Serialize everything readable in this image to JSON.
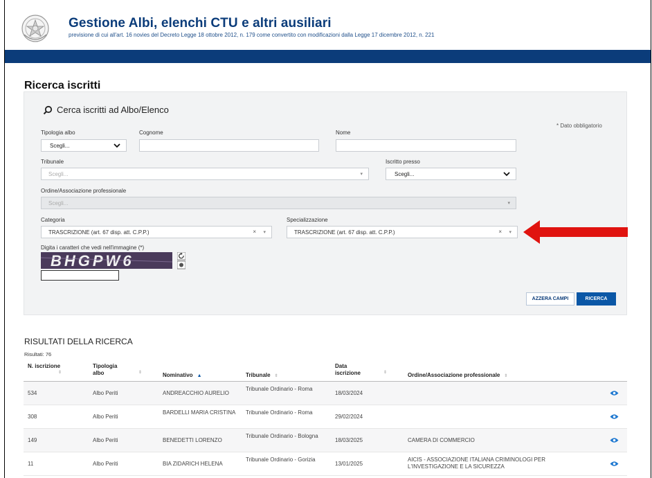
{
  "header": {
    "title": "Gestione Albi, elenchi CTU e altri ausiliari",
    "subtitle": "previsione di cui all'art. 16 novies del Decreto Legge 18 ottobre 2012, n. 179 come convertito con modificazioni dalla Legge 17 dicembre 2012, n. 221",
    "emblem_icon": "republic-emblem-icon",
    "brand_color": "#0b3c7a"
  },
  "page": {
    "title": "Ricerca iscritti"
  },
  "search": {
    "heading": "Cerca iscritti ad Albo/Elenco",
    "heading_icon": "search-icon",
    "required_note": "* Dato obbligatorio",
    "tipologia": {
      "label": "Tipologia albo",
      "value": "Scegli..."
    },
    "cognome": {
      "label": "Cognome",
      "value": ""
    },
    "nome": {
      "label": "Nome",
      "value": ""
    },
    "tribunale": {
      "label": "Tribunale",
      "placeholder": "Scegli..."
    },
    "iscritto_presso": {
      "label": "Iscritto presso",
      "value": "Scegli..."
    },
    "ordine": {
      "label": "Ordine/Associazione professionale",
      "placeholder": "Scegli..."
    },
    "categoria": {
      "label": "Categoria",
      "value": "TRASCRIZIONE (art. 67 disp. att. C.P.P.)",
      "clear": "×"
    },
    "specializzazione": {
      "label": "Specializzazione",
      "value": "TRASCRIZIONE (art. 67 disp. att. C.P.P.)",
      "clear": "×"
    },
    "captcha": {
      "label": "Digita i caratteri che vedi nell'immagine (*)",
      "text": "BHGPW6",
      "value": ""
    },
    "reset_label": "AZZERA CAMPI",
    "search_label": "RICERCA",
    "accent_color": "#0b57a6",
    "annotation_color": "#e0130f"
  },
  "results": {
    "title": "RISULTATI DELLA RICERCA",
    "count": "Risultati: 76",
    "columns": [
      "N. iscrizione",
      "Tipologia albo",
      "Nominativo",
      "Tribunale",
      "Data iscrizione",
      "Ordine/Associazione professionale"
    ],
    "rows": [
      {
        "n": "534",
        "tipologia": "Albo Periti",
        "nominativo": "ANDREACCHIO AURELIO",
        "tribunale": "Tribunale Ordinario - Roma",
        "data": "18/03/2024",
        "ordine": ""
      },
      {
        "n": "308",
        "tipologia": "Albo Periti",
        "nominativo": "BARDELLI MARIA CRISTINA",
        "tribunale": "Tribunale Ordinario - Roma",
        "data": "29/02/2024",
        "ordine": ""
      },
      {
        "n": "149",
        "tipologia": "Albo Periti",
        "nominativo": "BENEDETTI LORENZO",
        "tribunale": "Tribunale Ordinario - Bologna",
        "data": "18/03/2025",
        "ordine": "CAMERA DI COMMERCIO"
      },
      {
        "n": "11",
        "tipologia": "Albo Periti",
        "nominativo": "BIA ZIDARICH HELENA",
        "tribunale": "Tribunale Ordinario - Gorizia",
        "data": "13/01/2025",
        "ordine": "AICIS - ASSOCIAZIONE ITALIANA CRIMINOLOGI PER L'INVESTIGAZIONE E LA SICUREZZA"
      }
    ],
    "row_icon": "eye-icon"
  }
}
